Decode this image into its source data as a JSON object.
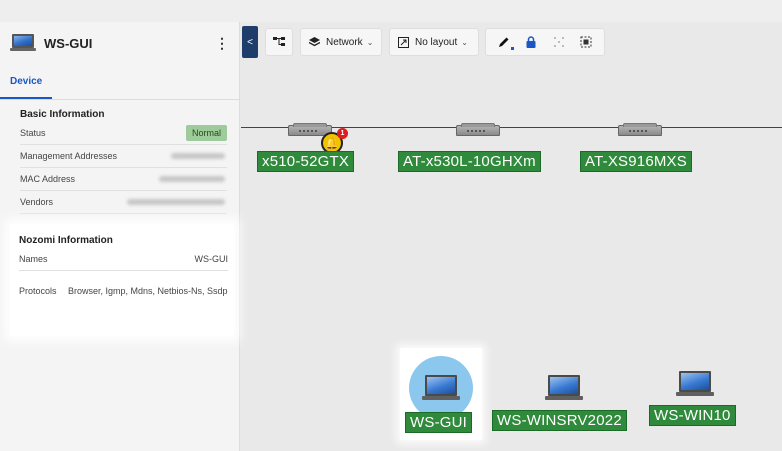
{
  "panel": {
    "title": "WS-GUI",
    "menu_glyph": "⋮",
    "tabs": [
      {
        "label": "Device",
        "active": true
      }
    ],
    "basic": {
      "title": "Basic Information",
      "rows": [
        {
          "label": "Status",
          "value": "Normal"
        },
        {
          "label": "Management Addresses"
        },
        {
          "label": "MAC Address"
        },
        {
          "label": "Vendors"
        }
      ]
    },
    "nozomi": {
      "title": "Nozomi Information",
      "names_label": "Names",
      "names_value": "WS-GUI",
      "protocols_label": "Protocols",
      "protocols_value": "Browser, Igmp, Mdns, Netbios-Ns, Ssdp"
    }
  },
  "toolbar": {
    "collapse_glyph": "<",
    "network_label": "Network",
    "layout_label": "No layout",
    "icons": [
      "hierarchy-icon",
      "layers-icon",
      "layout-icon",
      "pencil-icon",
      "lock-icon",
      "scatter-icon",
      "fit-icon"
    ]
  },
  "graph": {
    "switches": [
      {
        "label": "x510-52GTX",
        "alert_count": "1"
      },
      {
        "label": "AT-x530L-10GHXm"
      },
      {
        "label": "AT-XS916MXS"
      }
    ],
    "hosts": [
      {
        "label": "WS-GUI",
        "selected": true
      },
      {
        "label": "WS-WINSRV2022"
      },
      {
        "label": "WS-WIN10"
      }
    ]
  },
  "colors": {
    "accent": "#1a56c4",
    "node_label_bg": "#2f8a3b",
    "status_normal_bg": "#9ecb9a",
    "selected_halo": "#8cc8ee",
    "alert_yellow": "#f2c200",
    "alert_red": "#d81e1e"
  }
}
